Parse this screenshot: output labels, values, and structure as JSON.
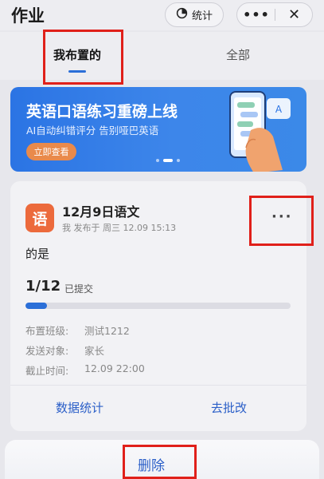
{
  "header": {
    "title": "作业",
    "stats_label": "统计",
    "more_glyph": "•••",
    "close_glyph": "✕"
  },
  "tabs": [
    {
      "label": "我布置的",
      "active": true
    },
    {
      "label": "全部",
      "active": false
    }
  ],
  "banner": {
    "title": "英语口语练习重磅上线",
    "subtitle": "AI自动纠错评分 告别哑巴英语",
    "button": "立即查看",
    "bg_color": "#2b74e4",
    "button_color": "#e98a4b"
  },
  "homework": {
    "subject_char": "语",
    "subject_color": "#ec6a3c",
    "title": "12月9日语文",
    "meta": "我 发布于 周三 12.09 15:13",
    "more_glyph": "···",
    "content": "的是",
    "submitted": "1/12",
    "submitted_label": "已提交",
    "progress": 0.08,
    "info": [
      {
        "label": "布置班级:",
        "value": "测试1212"
      },
      {
        "label": "发送对象:",
        "value": "家长"
      },
      {
        "label": "截止时间:",
        "value": "12.09 22:00"
      }
    ],
    "actions": {
      "stats": "数据统计",
      "grade": "去批改"
    }
  },
  "sheet": {
    "delete_label": "删除"
  },
  "colors": {
    "accent": "#2b6fd8",
    "highlight_box": "#e0201a"
  }
}
